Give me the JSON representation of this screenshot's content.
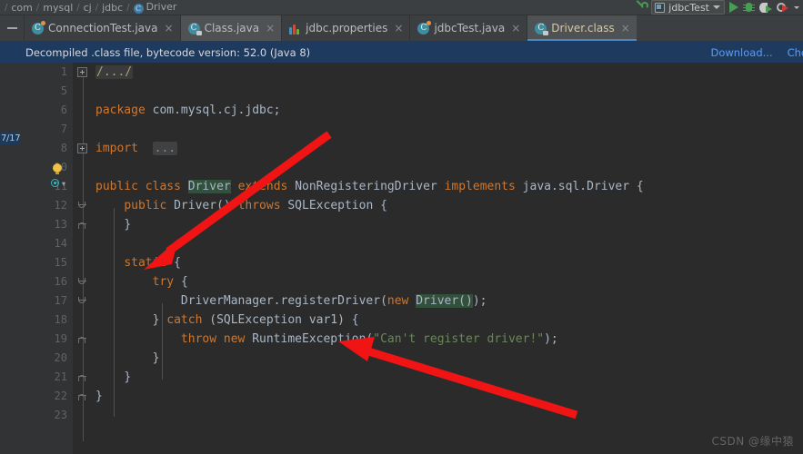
{
  "breadcrumb": {
    "items": [
      "com",
      "mysql",
      "cj",
      "jdbc",
      "Driver"
    ],
    "separator": "/"
  },
  "toolbar": {
    "run_config_name": "jdbcTest",
    "icons": [
      "wrench-icon",
      "run-config-icon",
      "run-icon",
      "debug-icon",
      "run-with-coverage-icon",
      "profile-icon",
      "dropdown-caret-icon"
    ]
  },
  "tabs": [
    {
      "label": "ConnectionTest.java",
      "icon": "java-file-icon",
      "active": false,
      "close": "×"
    },
    {
      "label": "Class.java",
      "icon": "java-class-file-icon",
      "active": false,
      "close": "×"
    },
    {
      "label": "jdbc.properties",
      "icon": "properties-file-icon",
      "active": false,
      "close": "×"
    },
    {
      "label": "jdbcTest.java",
      "icon": "java-file-icon",
      "active": false,
      "close": "×"
    },
    {
      "label": "Driver.class",
      "icon": "compiled-class-icon",
      "active": true,
      "close": "×"
    }
  ],
  "banner": {
    "message": "Decompiled .class file, bytecode version: 52.0 (Java 8)",
    "download_link": "Download...",
    "choose_link": "Choos"
  },
  "editor": {
    "marker_badge": "7/17",
    "line_numbers": [
      "1",
      "5",
      "6",
      "7",
      "8",
      "10",
      "11",
      "12",
      "13",
      "14",
      "15",
      "16",
      "17",
      "18",
      "19",
      "20",
      "21",
      "22",
      "23"
    ],
    "lines": [
      {
        "num": "1",
        "text": "/.../"
      },
      {
        "num": "5",
        "text": ""
      },
      {
        "num": "6",
        "text": "package com.mysql.cj.jdbc;"
      },
      {
        "num": "7",
        "text": ""
      },
      {
        "num": "8",
        "text": "import ..."
      },
      {
        "num": "10",
        "text": ""
      },
      {
        "num": "11",
        "text": "public class Driver extends NonRegisteringDriver implements java.sql.Driver {"
      },
      {
        "num": "12",
        "text": "    public Driver() throws SQLException {"
      },
      {
        "num": "13",
        "text": "    }"
      },
      {
        "num": "14",
        "text": ""
      },
      {
        "num": "15",
        "text": "    static {"
      },
      {
        "num": "16",
        "text": "        try {"
      },
      {
        "num": "17",
        "text": "            DriverManager.registerDriver(new Driver());"
      },
      {
        "num": "18",
        "text": "        } catch (SQLException var1) {"
      },
      {
        "num": "19",
        "text": "            throw new RuntimeException(\"Can't register driver!\");"
      },
      {
        "num": "20",
        "text": "        }"
      },
      {
        "num": "21",
        "text": "    }"
      },
      {
        "num": "22",
        "text": "}"
      },
      {
        "num": "23",
        "text": ""
      }
    ],
    "tokens": {
      "package_kw": "package",
      "package_name": "com.mysql.cj.jdbc;",
      "import_kw": "import",
      "import_dots": "...",
      "public_kw": "public",
      "class_kw": "class",
      "class_name": "Driver",
      "extends_kw": "extends",
      "super_name": "NonRegisteringDriver",
      "implements_kw": "implements",
      "iface_name": "java.sql.Driver",
      "open_brace": "{",
      "ctor": "Driver()",
      "throws_kw": "throws",
      "sqlexception": "SQLException",
      "close_brace": "}",
      "static_kw": "static",
      "try_kw": "try",
      "register_call": "DriverManager.registerDriver(",
      "new_kw": "new",
      "driver_new": "Driver()",
      "end_call": ");",
      "catch_kw": "catch",
      "catch_args": "(SQLException var1) {",
      "throw_kw": "throw",
      "runtime_ex": "RuntimeException(",
      "msg": "\"Can't register driver!\"",
      "semi_close": ");",
      "fold_comment": "/.../"
    }
  },
  "watermark": "CSDN @缘中猿",
  "colors": {
    "editor_bg": "#2b2b2b",
    "gutter_bg": "#313335",
    "chrome_bg": "#3c3f41",
    "banner_bg": "#1f3a5f",
    "link": "#589df6",
    "keyword": "#cc7832",
    "string": "#6a8759",
    "text": "#a9b7c6",
    "accent_tab": "#4a88c7",
    "arrow": "#f01414"
  }
}
